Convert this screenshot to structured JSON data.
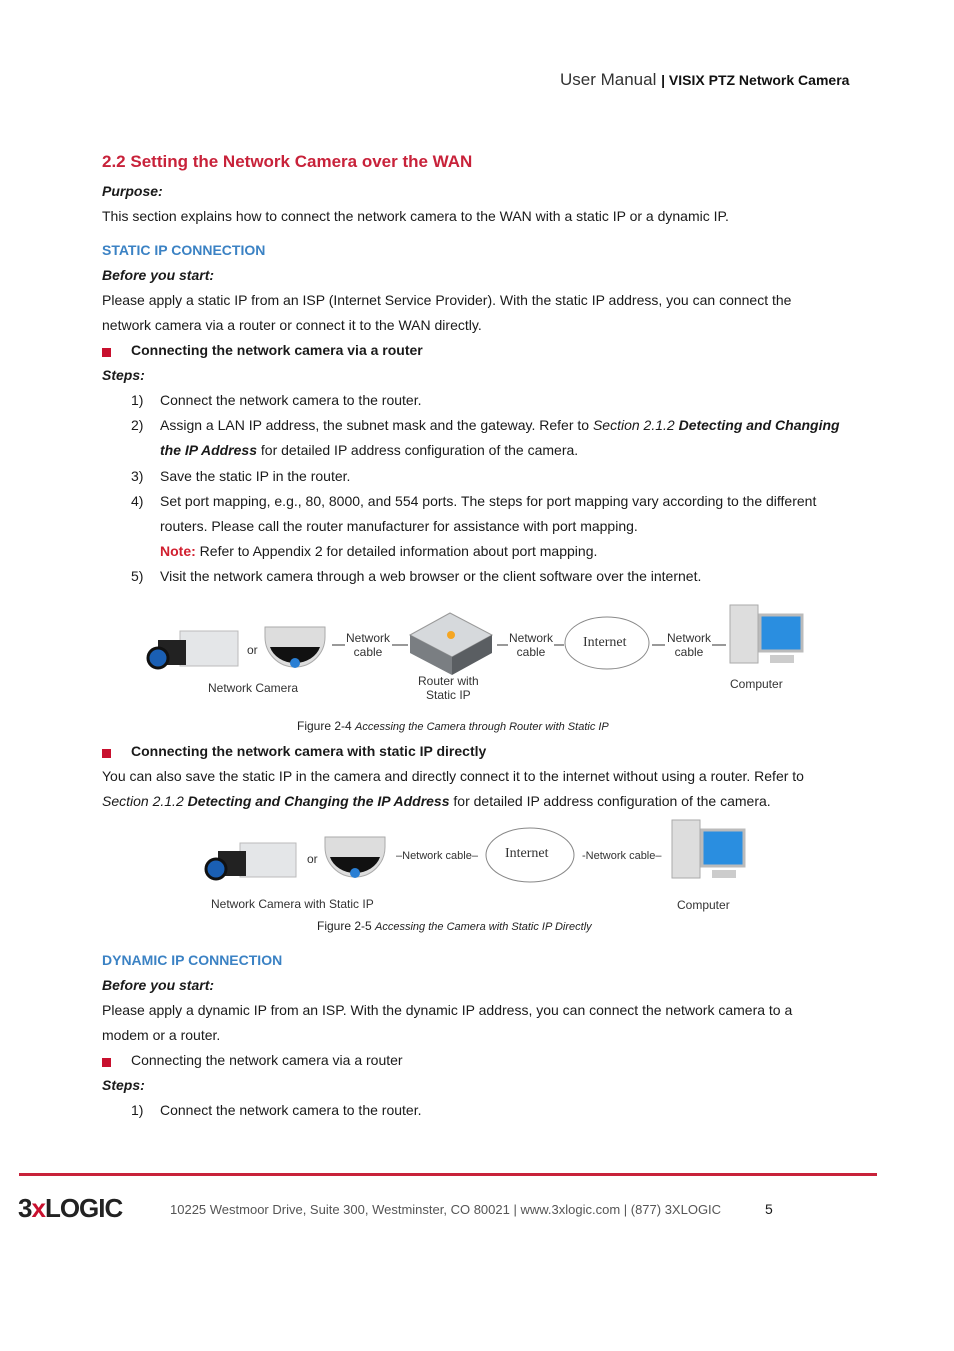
{
  "header": {
    "title": "User Manual",
    "product": "VISIX PTZ Network Camera"
  },
  "section": {
    "number": "2.2",
    "title": "Setting the Network Camera over the WAN"
  },
  "purpose_label": "Purpose:",
  "purpose_text": "This section explains how to connect the network camera to the WAN with a static IP or a dynamic IP.",
  "static": {
    "heading": "STATIC IP CONNECTION",
    "before_label": "Before you start:",
    "before_text_1": "Please apply a static IP from an ISP (Internet Service Provider). With the static IP address, you can connect the",
    "before_text_2": "network camera via a router or connect it to the WAN directly.",
    "bullet1": "Connecting the network camera via a router",
    "steps_label": "Steps:",
    "steps": [
      {
        "n": "1)",
        "t": "Connect the network camera to the router."
      },
      {
        "n": "2)",
        "a": "Assign a LAN IP address, the subnet mask and the gateway. Refer to ",
        "b": "Section 2.1.2 ",
        "c": "Detecting and Changing",
        "d": "the IP Address",
        "e": " for detailed IP address configuration of the camera."
      },
      {
        "n": "3)",
        "t": "Save the static IP in the router."
      },
      {
        "n": "4)",
        "t": "Set port mapping, e.g., 80, 8000, and 554 ports. The steps for port mapping vary according to the different",
        "t2": "routers. Please call the router manufacturer for assistance with port mapping.",
        "note_label": "Note:",
        "note": " Refer to Appendix 2 for detailed information about port mapping."
      },
      {
        "n": "5)",
        "t": "Visit the network camera through a web browser or the client software over the internet."
      }
    ],
    "fig1": {
      "or": "or",
      "camera": "Network Camera",
      "cable": "Network",
      "cable2": "cable",
      "router1": "Router with",
      "router2": "Static IP",
      "internet": "Internet",
      "computer": "Computer",
      "caption_num": "Figure 2-4 ",
      "caption": "Accessing the Camera through Router with Static IP"
    },
    "bullet2": "Connecting the network camera with static IP directly",
    "direct_1": "You can also save the static IP in the camera and directly connect it to the internet without using a router. Refer to",
    "direct_2a": "Section 2.1.2 ",
    "direct_2b": "Detecting and Changing the IP Address",
    "direct_2c": " for detailed IP address configuration of the camera.",
    "fig2": {
      "or": "or",
      "cable": "Network cable",
      "camera": "Network Camera with Static IP",
      "internet": "Internet",
      "computer": "Computer",
      "caption_num": "Figure 2-5 ",
      "caption": "Accessing the Camera with Static IP Directly"
    }
  },
  "dynamic": {
    "heading": "DYNAMIC IP CONNECTION",
    "before_label": "Before you start:",
    "text_1": "Please apply a dynamic IP from an ISP. With the dynamic IP address, you can connect the network camera to a",
    "text_2": "modem or a router.",
    "bullet": "Connecting the network camera via a router",
    "steps_label": "Steps:",
    "step1_n": "1)",
    "step1": "Connect the network camera to the router."
  },
  "footer": {
    "logo": "3xLOGIC",
    "address": "10225 Westmoor Drive, Suite 300, Westminster, CO 80021 | www.3xlogic.com | (877) 3XLOGIC",
    "page": "5"
  },
  "colors": {
    "heading": "#c8223a",
    "subheading": "#3b82c4",
    "rule": "#c8223a"
  }
}
